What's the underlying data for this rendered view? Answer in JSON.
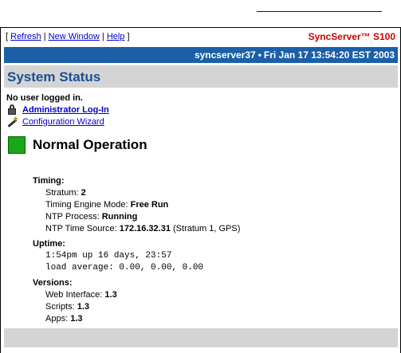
{
  "nav": {
    "refresh": "Refresh",
    "new_window": "New Window",
    "help": "Help",
    "open_bracket": "[",
    "close_bracket": "]",
    "sep": "|"
  },
  "brand": {
    "sync": "Sync",
    "rest": "Server™ S100"
  },
  "header_bar": {
    "host": "syncserver37",
    "dot": "•",
    "datetime": "Fri Jan 17 13:54:20 EST 2003"
  },
  "page_title": "System Status",
  "login": {
    "no_user": "No user logged in.",
    "admin_login": "Administrator Log-In",
    "config_wizard": "Configuration Wizard"
  },
  "status": {
    "label": "Normal Operation",
    "color": "#1aa51a"
  },
  "timing": {
    "heading": "Timing:",
    "stratum_label": "Stratum: ",
    "stratum_value": "2",
    "mode_label": "Timing Engine Mode: ",
    "mode_value": "Free Run",
    "ntp_process_label": "NTP Process: ",
    "ntp_process_value": "Running",
    "ntp_source_label": "NTP Time Source: ",
    "ntp_source_value": "172.16.32.31",
    "ntp_source_extra": " (Stratum 1, GPS)"
  },
  "uptime": {
    "heading": "Uptime:",
    "line1": "1:54pm up 16 days, 23:57",
    "line2": "load average: 0.00, 0.00, 0.00"
  },
  "versions": {
    "heading": "Versions:",
    "web_label": "Web Interface: ",
    "web_value": "1.3",
    "scripts_label": "Scripts: ",
    "scripts_value": "1.3",
    "apps_label": "Apps: ",
    "apps_value": "1.3"
  },
  "colors": {
    "accent_blue": "#1a5fa8",
    "title_blue": "#1a4f95",
    "brand_red": "#cc0000",
    "panel_gray": "#d4d4d4"
  }
}
